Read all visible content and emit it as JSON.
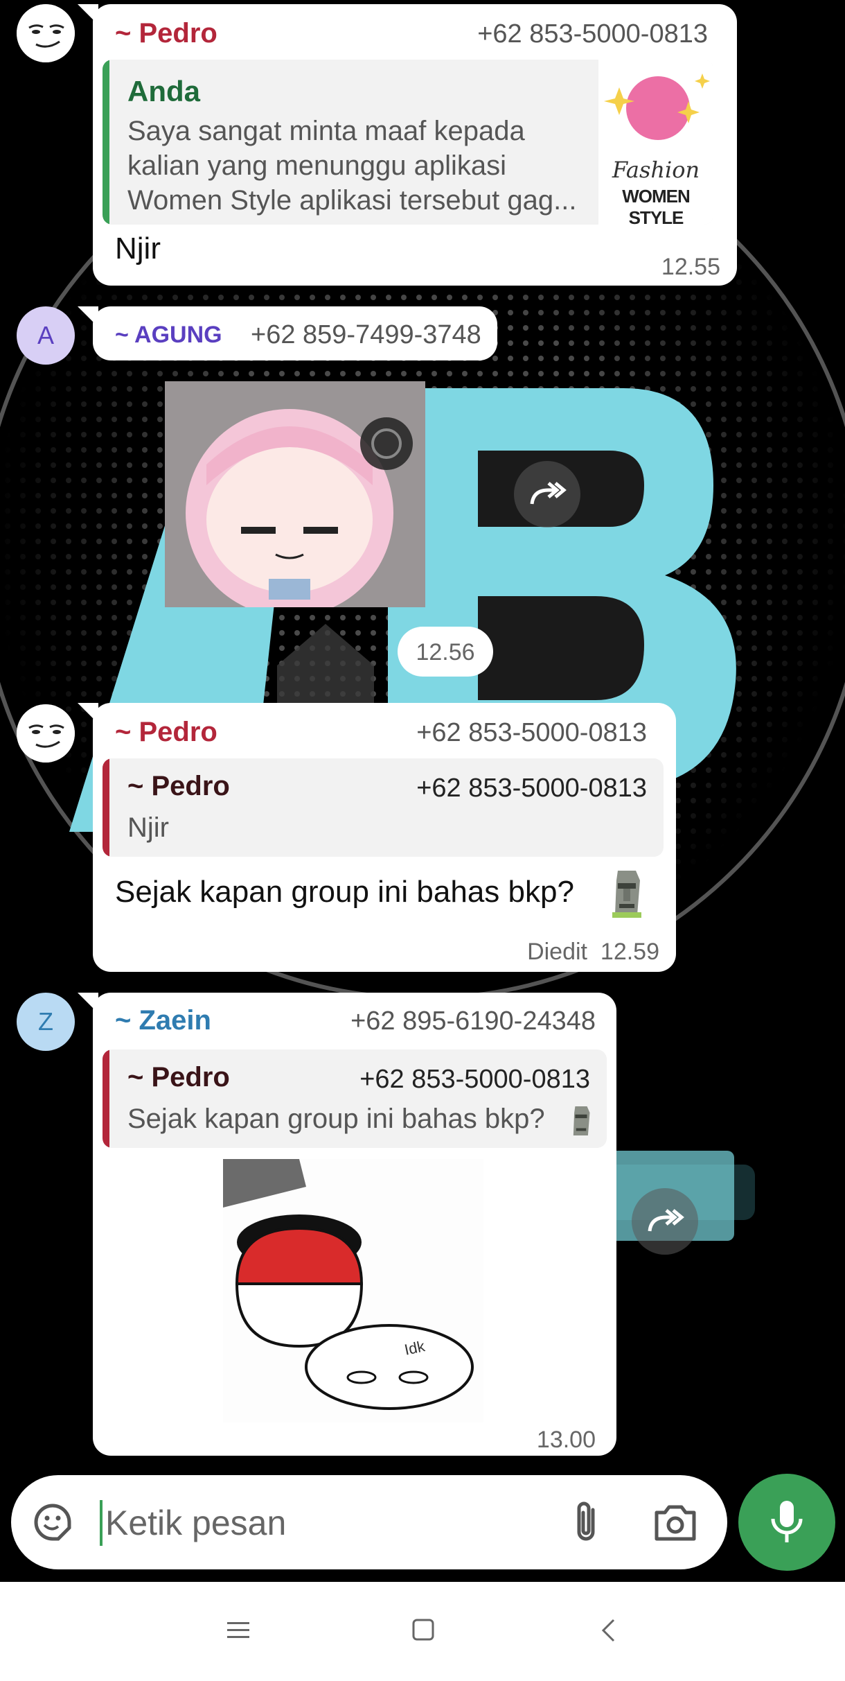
{
  "messages": [
    {
      "sender": "~ Pedro",
      "phone": "+62 853-5000-0813",
      "quote": {
        "author": "Anda",
        "lines": [
          "Saya sangat minta maaf kepada",
          "kalian yang menunggu aplikasi",
          "Women Style aplikasi tersebut gag..."
        ],
        "thumb": {
          "line1": "Fashion",
          "line2": "WOMEN STYLE"
        }
      },
      "text": "Njir",
      "time": "12.55"
    },
    {
      "sender": "~ AGUNG",
      "phone": "+62 859-7499-3748",
      "avatar_letter": "A",
      "sticker": "anime-girl-sticker",
      "time": "12.56"
    },
    {
      "sender": "~ Pedro",
      "phone": "+62 853-5000-0813",
      "quote": {
        "author": "~ Pedro",
        "phone": "+62 853-5000-0813",
        "text": "Njir"
      },
      "text": "Sejak kapan group ini bahas bkp?",
      "edited_label": "Diedit",
      "time": "12.59"
    },
    {
      "sender": "~ Zaein",
      "phone": "+62 895-6190-24348",
      "avatar_letter": "Z",
      "quote": {
        "author": "~ Pedro",
        "phone": "+62 853-5000-0813",
        "text": "Sejak kapan group ini bahas bkp?"
      },
      "image": "polandball-sticker",
      "image_caption": "Idk",
      "time": "13.00"
    }
  ],
  "composer": {
    "placeholder": "Ketik pesan",
    "icons": [
      "emoji-sticker-icon",
      "attachment-icon",
      "camera-icon",
      "microphone-icon"
    ]
  },
  "colors": {
    "pedro": "#b3263a",
    "agung": "#5a3fc0",
    "zaein": "#2f7cb0",
    "anda": "#1f6b3a",
    "mic": "#3aa057",
    "wallpaper_accent": "#7fd7e3"
  }
}
